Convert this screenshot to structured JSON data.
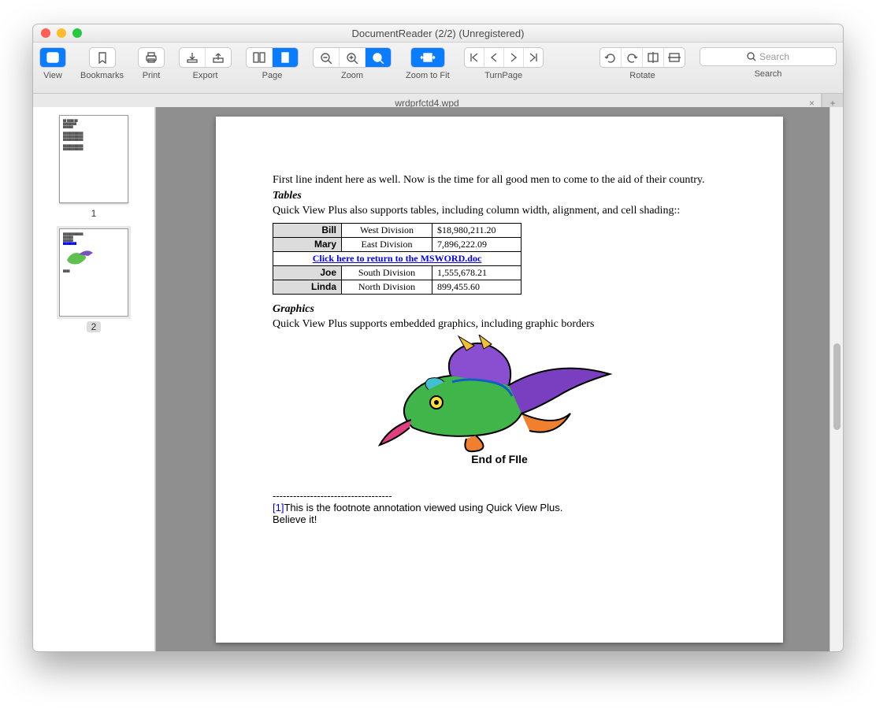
{
  "window": {
    "title": "DocumentReader (2/2) (Unregistered)"
  },
  "toolbar": {
    "view": "View",
    "bookmarks": "Bookmarks",
    "print": "Print",
    "export": "Export",
    "page": "Page",
    "zoom": "Zoom",
    "zoomfit": "Zoom to Fit",
    "turnpage": "TurnPage",
    "rotate": "Rotate",
    "search": "Search",
    "search_placeholder": "Search"
  },
  "tab": {
    "name": "wrdprfctd4.wpd",
    "close": "×",
    "plus": "+"
  },
  "thumbs": {
    "p1": "1",
    "p2": "2"
  },
  "doc": {
    "para1": "First line indent here as well.  Now is the time for all good men to come to the aid of their country.",
    "h_tables": "Tables",
    "para2": "Quick View Plus also supports tables, including column width, alignment, and cell shading::",
    "link_row": "Click here to return to the MSWORD.doc",
    "rows": [
      {
        "name": "Bill",
        "division": "West Division",
        "value": "$18,980,211.20"
      },
      {
        "name": "Mary",
        "division": "East Division",
        "value": "7,896,222.09"
      },
      {
        "name": "Joe",
        "division": "South Division",
        "value": "1,555,678.21"
      },
      {
        "name": "Linda",
        "division": "North Division",
        "value": "899,455.60"
      }
    ],
    "h_graphics": "Graphics",
    "para3": "Quick View Plus supports embedded graphics, including graphic borders",
    "eof": "End of FIle",
    "hr": "-----------------------------------",
    "foot_ref": "[1]",
    "foot1": "This is the footnote annotation viewed using Quick View Plus.",
    "foot2": "Believe it!"
  }
}
